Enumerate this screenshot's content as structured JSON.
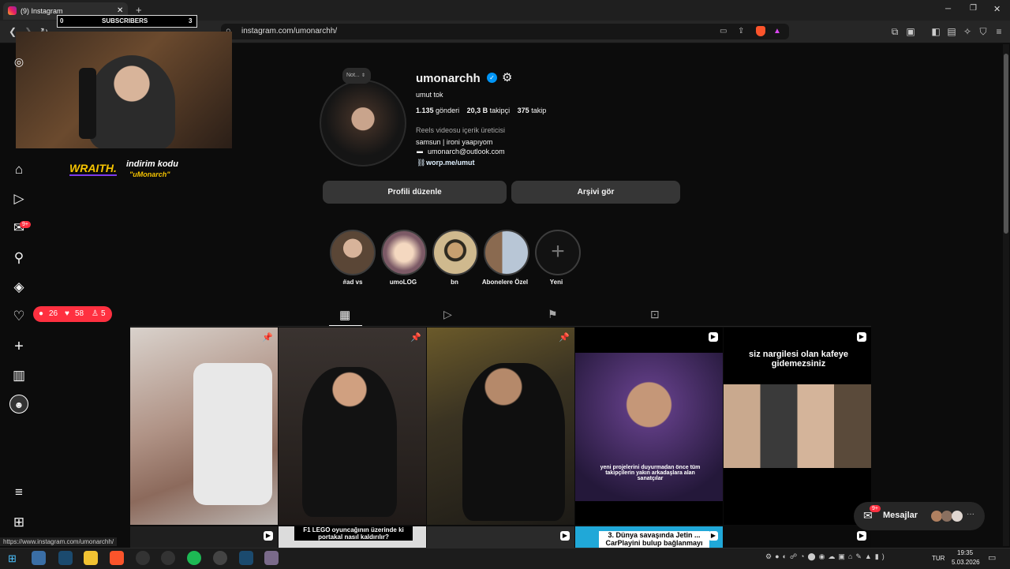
{
  "browser": {
    "tab_title": "(9) Instagram",
    "new_tab": "+",
    "url": "instagram.com/umonarchh/",
    "status_url": "https://www.instagram.com/umonarchh/",
    "window_controls": [
      "─",
      "❐",
      "✕"
    ]
  },
  "stream_overlay": {
    "subs_start": "0",
    "subs_label": "SUBSCRIBERS",
    "subs_end": "3",
    "sponsor_brand": "WRAITH.",
    "promo_line1": "indirim kodu",
    "promo_line2": "\"uMonarch\""
  },
  "notifications": {
    "comments": "26",
    "likes": "58",
    "follows": "5",
    "share_badge": "9+"
  },
  "profile": {
    "note": "Not...",
    "username": "umonarchh",
    "full_name": "umut tok",
    "posts_count": "1.135",
    "posts_label": "gönderi",
    "followers_count": "20,3 B",
    "followers_label": "takipçi",
    "following_count": "375",
    "following_label": "takip",
    "category": "Reels videosu içerik üreticisi",
    "bio_line1": "samsun | ironi yaapıyom",
    "bio_email": "umonarch@outlook.com",
    "bio_link": "worp.me/umut",
    "edit_button": "Profili düzenle",
    "archive_button": "Arşivi gör"
  },
  "highlights": [
    {
      "label": "#ad vs"
    },
    {
      "label": "umoLOG"
    },
    {
      "label": "bn"
    },
    {
      "label": "Abonelere Özel"
    },
    {
      "label": "Yeni"
    }
  ],
  "posts": [
    {
      "caption": "",
      "type": "pinned"
    },
    {
      "caption": "",
      "type": "pinned"
    },
    {
      "caption": "",
      "type": "pinned"
    },
    {
      "caption": "yeni projelerini duyurmadan önce tüm takipçilerin yakın arkadaşlara alan sanatçılar",
      "type": "reel"
    },
    {
      "caption": "siz nargilesi olan kafeye gidemezsiniz",
      "type": "reel"
    }
  ],
  "posts_row2": [
    {
      "caption": ""
    },
    {
      "caption": "F1 LEGO oyuncağının üzerinde ki portakal nasıl kaldırılır?"
    },
    {
      "caption": ""
    },
    {
      "caption": "3. Dünya savaşında Jetin ... CarPlayini bulup bağlanmayı"
    },
    {
      "caption": ""
    }
  ],
  "messages": {
    "label": "Mesajlar",
    "badge": "9+"
  },
  "taskbar": {
    "lang": "TUR",
    "time": "19:35",
    "date": "5.03.2026"
  }
}
